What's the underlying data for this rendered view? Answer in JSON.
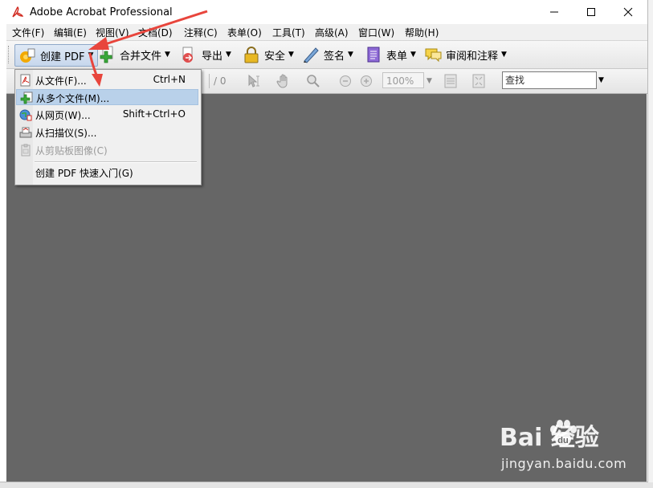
{
  "window": {
    "title": "Adobe Acrobat Professional"
  },
  "menubar": {
    "items": [
      "文件(F)",
      "编辑(E)",
      "视图(V)",
      "文档(D)",
      "注释(C)",
      "表单(O)",
      "工具(T)",
      "高级(A)",
      "窗口(W)",
      "帮助(H)"
    ]
  },
  "toolbar": {
    "create_pdf": "创建 PDF",
    "combine": "合并文件",
    "export": "导出",
    "secure": "安全",
    "sign": "签名",
    "forms": "表单",
    "review": "审阅和注释"
  },
  "nav_toolbar": {
    "page_total": "/ 0",
    "zoom": "100%",
    "search_value": "查找"
  },
  "dropdown": {
    "items": [
      {
        "label": "从文件(F)...",
        "shortcut": "Ctrl+N",
        "icon": "file-pdf-icon"
      },
      {
        "label": "从多个文件(M)...",
        "shortcut": "",
        "icon": "multi-file-icon"
      },
      {
        "label": "从网页(W)...",
        "shortcut": "Shift+Ctrl+O",
        "icon": "web-page-icon"
      },
      {
        "label": "从扫描仪(S)...",
        "shortcut": "",
        "icon": "scanner-icon"
      },
      {
        "label": "从剪贴板图像(C)",
        "shortcut": "",
        "icon": "clipboard-icon"
      },
      {
        "label": "创建 PDF 快速入门(G)",
        "shortcut": "",
        "icon": ""
      }
    ]
  },
  "watermark": {
    "brand": "Bai  经验",
    "url": "jingyan.baidu.com"
  },
  "colors": {
    "canvas": "#666666",
    "menu_highlight": "#b9d1ea",
    "arrow": "#e8453c"
  }
}
